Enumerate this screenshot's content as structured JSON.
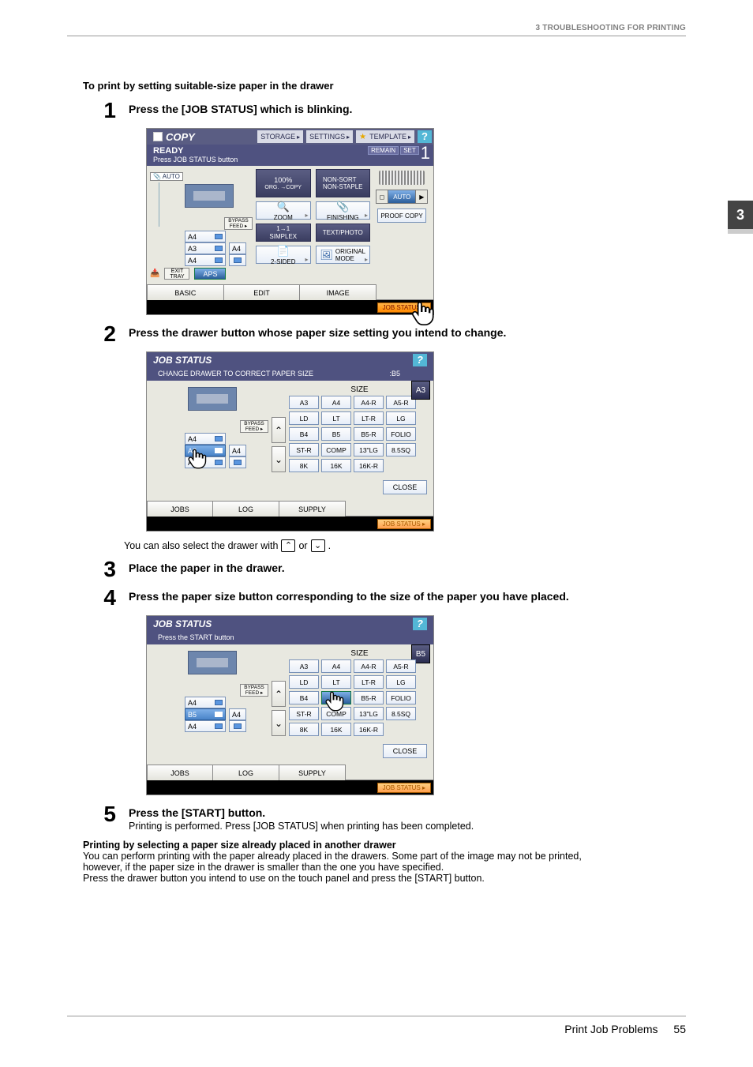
{
  "header": {
    "title": "3 TROUBLESHOOTING FOR PRINTING"
  },
  "chapter_tab": "3",
  "intro": "To print by setting suitable-size paper in the drawer",
  "steps": {
    "s1": {
      "num": "1",
      "title": "Press the [JOB STATUS] which is blinking."
    },
    "s2": {
      "num": "2",
      "title": "Press the drawer button whose paper size setting you intend to change."
    },
    "s3": {
      "num": "3",
      "title": "Place the paper in the drawer."
    },
    "s4": {
      "num": "4",
      "title": "Press the paper size button corresponding to the size of the paper you have placed."
    },
    "s5": {
      "num": "5",
      "title": "Press the [START] button.",
      "desc": "Printing is performed. Press [JOB STATUS] when printing has been completed."
    }
  },
  "note2": {
    "pre": "You can also select the drawer with ",
    "or_word": " or ",
    "post": "."
  },
  "para": {
    "heading": "Printing by selecting a paper size already placed in another drawer",
    "l1": "You can perform printing with the paper already placed in the drawers. Some part of the image may not be printed,",
    "l2": "however, if the paper size in the drawer is smaller than the one you have specified.",
    "l3": "Press the drawer button you intend to use on the touch panel and press the [START] button."
  },
  "footer": {
    "section": "Print Job Problems",
    "page": "55"
  },
  "copy_panel": {
    "title": "COPY",
    "chips": {
      "storage": "STORAGE",
      "settings": "SETTINGS",
      "template": "TEMPLATE"
    },
    "help": "?",
    "ready": "READY",
    "prompt": "Press JOB STATUS button",
    "counter": {
      "remain": "REMAIN",
      "set": "SET",
      "value": "1"
    },
    "auto": "AUTO",
    "drawers": {
      "d1": "A4",
      "d2": "A3",
      "d3": "A4",
      "right_small1": "A4",
      "right_small2": ""
    },
    "bypass": {
      "l1": "BYPASS",
      "l2": "FEED ▸"
    },
    "exit_tray": {
      "l1": "EXIT",
      "l2": "TRAY"
    },
    "aps": "APS",
    "mid": {
      "zoom_pct": "100%",
      "zoom_sub": "ORG. →COPY",
      "zoom": "ZOOM",
      "nonsort": "NON-SORT\nNON-STAPLE",
      "finishing": "FINISHING",
      "simplex_top": "1→1",
      "simplex": "SIMPLEX",
      "twosided": "2-SIDED",
      "textphoto": "TEXT/PHOTO",
      "original": "ORIGINAL\nMODE"
    },
    "right": {
      "auto": "AUTO",
      "proof": "PROOF COPY"
    },
    "tabs": {
      "basic": "BASIC",
      "edit": "EDIT",
      "image": "IMAGE"
    },
    "jobstatus": "JOB STATUS"
  },
  "js1": {
    "title": "JOB STATUS",
    "help": "?",
    "message": "CHANGE DRAWER TO CORRECT PAPER SIZE",
    "val": ":B5",
    "indicator": "A3",
    "left_drawers": {
      "d1": "A4",
      "d2": "A3",
      "d3": "A4",
      "r1": "A4",
      "r2": ""
    },
    "bypass": {
      "l1": "BYPASS",
      "l2": "FEED ▸"
    },
    "size_hdr": "SIZE",
    "sizes": {
      "r0": [
        "A3",
        "A4",
        "A4-R",
        "A5-R"
      ],
      "r1": [
        "LD",
        "LT",
        "LT-R",
        "LG"
      ],
      "r2": [
        "B4",
        "B5",
        "B5-R",
        "FOLIO"
      ],
      "r3": [
        "ST-R",
        "COMP",
        "13\"LG",
        "8.5SQ"
      ],
      "r4": [
        "8K",
        "16K",
        "16K-R",
        ""
      ]
    },
    "close": "CLOSE",
    "tabs": {
      "jobs": "JOBS",
      "log": "LOG",
      "supply": "SUPPLY"
    },
    "jobstatus": "JOB STATUS"
  },
  "js2": {
    "title": "JOB STATUS",
    "help": "?",
    "message": "Press the START button",
    "indicator": "B5",
    "left_drawers": {
      "d1": "A4",
      "d2": "B5",
      "d3": "A4",
      "r1": "A4",
      "r2": ""
    },
    "bypass": {
      "l1": "BYPASS",
      "l2": "FEED ▸"
    },
    "size_hdr": "SIZE",
    "sizes": {
      "r0": [
        "A3",
        "A4",
        "A4-R",
        "A5-R"
      ],
      "r1": [
        "LD",
        "LT",
        "LT-R",
        "LG"
      ],
      "r2": [
        "B4",
        "B5",
        "B5-R",
        "FOLIO"
      ],
      "r3": [
        "ST-R",
        "COMP",
        "13\"LG",
        "8.5SQ"
      ],
      "r4": [
        "8K",
        "16K",
        "16K-R",
        ""
      ]
    },
    "close": "CLOSE",
    "tabs": {
      "jobs": "JOBS",
      "log": "LOG",
      "supply": "SUPPLY"
    },
    "jobstatus": "JOB STATUS"
  }
}
